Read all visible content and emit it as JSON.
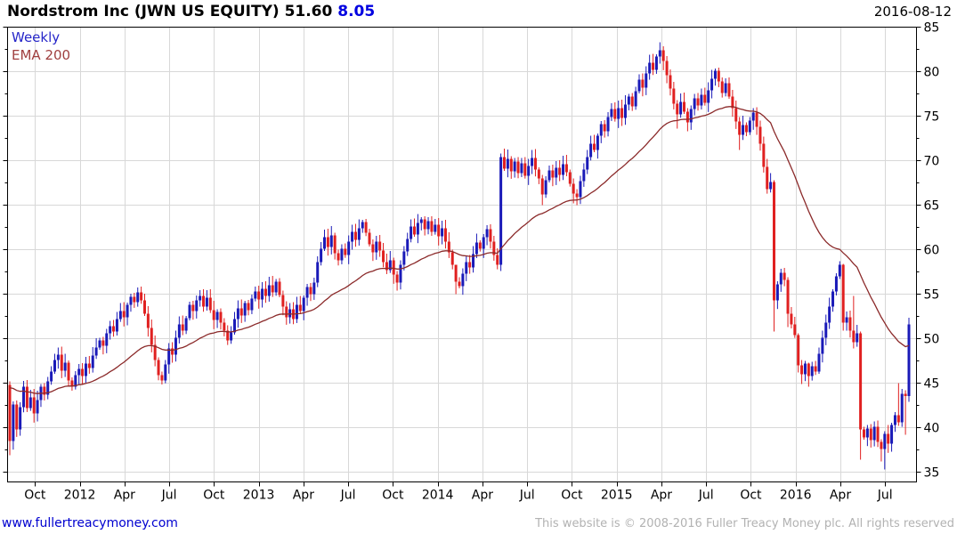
{
  "header": {
    "title_main": "Nordstrom Inc (JWN US EQUITY) 51.60",
    "change": "8.05",
    "date": "2016-08-12"
  },
  "legend": {
    "timeframe": "Weekly",
    "overlay": "EMA 200"
  },
  "footer": {
    "link": "www.fullertreacymoney.com",
    "copyright": "This website is © 2008-2016 Fuller Treacy Money plc. All rights reserved"
  },
  "colors": {
    "up_candle": "#1a1ab8",
    "down_candle": "#e02020",
    "ema_line": "#8b2a2a",
    "grid": "#d8d8d8",
    "axis": "#000000",
    "tick_label": "#000000"
  },
  "chart_data": {
    "type": "candlestick",
    "title": "Nordstrom Inc (JWN US EQUITY)",
    "timeframe": "weekly",
    "last_close": 51.6,
    "change": 8.05,
    "date": "2016-08-12",
    "y_axis": {
      "min_label": 35,
      "max_label": 85,
      "step": 5,
      "ticks": [
        85,
        80,
        75,
        70,
        65,
        60,
        55,
        50,
        45,
        40,
        35
      ],
      "minor_step": 2.5
    },
    "x_axis": {
      "tick_labels": [
        "Oct",
        "2012",
        "Apr",
        "Jul",
        "Oct",
        "2013",
        "Apr",
        "Jul",
        "Oct",
        "2014",
        "Apr",
        "Jul",
        "Oct",
        "2015",
        "Apr",
        "Jul",
        "Oct",
        "2016",
        "Apr",
        "Jul"
      ],
      "grid": true
    },
    "ema": {
      "label": "EMA 200",
      "period": 40
    },
    "series": {
      "name": "JWN weekly close",
      "first_open": 44.8,
      "closes": [
        38.5,
        42.6,
        39.8,
        42.3,
        44.6,
        42.2,
        43.4,
        41.6,
        43.1,
        44.6,
        43.7,
        45.2,
        46.3,
        47.6,
        48.2,
        46.4,
        47.3,
        45.3,
        44.6,
        45.9,
        46.6,
        45.8,
        47.2,
        46.7,
        48.1,
        49.0,
        49.8,
        49.2,
        50.6,
        51.4,
        50.8,
        52.2,
        53.1,
        52.4,
        53.8,
        54.7,
        54.1,
        55.2,
        54.3,
        52.8,
        51.2,
        49.3,
        47.6,
        45.9,
        45.3,
        47.1,
        48.9,
        48.2,
        50.1,
        51.6,
        50.9,
        52.3,
        53.8,
        53.1,
        54.3,
        54.8,
        53.6,
        54.6,
        53.2,
        52.1,
        53.0,
        51.8,
        50.9,
        49.8,
        50.7,
        52.2,
        53.4,
        52.6,
        54.0,
        53.2,
        54.5,
        55.3,
        54.4,
        55.6,
        54.8,
        56.0,
        55.2,
        56.4,
        54.9,
        53.6,
        52.4,
        53.3,
        52.2,
        53.8,
        53.1,
        54.6,
        55.8,
        55.0,
        56.3,
        58.6,
        60.1,
        61.4,
        60.3,
        61.6,
        59.6,
        58.8,
        60.1,
        59.4,
        60.9,
        62.0,
        61.1,
        62.4,
        63.1,
        61.9,
        60.6,
        59.7,
        60.9,
        59.9,
        58.6,
        57.7,
        58.8,
        57.2,
        56.3,
        58.3,
        59.8,
        61.2,
        62.6,
        61.7,
        63.0,
        63.4,
        62.3,
        63.2,
        62.0,
        62.8,
        61.5,
        62.4,
        60.9,
        59.7,
        58.3,
        56.4,
        55.9,
        57.3,
        58.6,
        58.0,
        59.5,
        60.8,
        60.1,
        61.4,
        62.3,
        60.9,
        59.4,
        58.3,
        70.4,
        69.1,
        70.2,
        68.8,
        69.9,
        68.6,
        69.7,
        68.3,
        69.4,
        70.3,
        69.0,
        68.0,
        66.2,
        67.8,
        68.9,
        68.1,
        69.2,
        68.4,
        69.6,
        68.7,
        67.4,
        66.3,
        65.9,
        67.7,
        69.0,
        70.4,
        71.9,
        71.2,
        72.8,
        74.1,
        73.3,
        74.9,
        75.8,
        74.7,
        75.9,
        74.8,
        76.3,
        77.2,
        76.1,
        77.8,
        79.1,
        78.2,
        79.8,
        81.0,
        80.2,
        81.7,
        82.4,
        81.2,
        79.6,
        78.1,
        76.4,
        75.2,
        76.6,
        75.5,
        74.3,
        75.8,
        77.0,
        76.2,
        77.4,
        76.5,
        77.9,
        79.2,
        80.1,
        78.9,
        77.6,
        78.7,
        77.2,
        75.9,
        74.4,
        72.9,
        74.0,
        73.2,
        74.5,
        75.4,
        73.8,
        71.9,
        69.3,
        66.8,
        67.6,
        54.3,
        56.1,
        57.4,
        56.6,
        52.8,
        51.6,
        50.4,
        47.0,
        46.0,
        47.2,
        45.8,
        46.9,
        46.3,
        48.3,
        50.1,
        51.8,
        53.6,
        55.3,
        57.0,
        58.3,
        51.8,
        52.4,
        50.9,
        49.6,
        50.6,
        39.8,
        38.9,
        39.9,
        38.6,
        40.1,
        38.4,
        37.6,
        39.3,
        38.2,
        40.3,
        41.4,
        40.6,
        43.8,
        43.55,
        51.6
      ],
      "wick_overrides": {
        "0": [
          36.9,
          45.2
        ],
        "129": [
          55.0,
          57.3
        ],
        "142": [
          57.6,
          70.8
        ],
        "154": [
          65.0,
          68.4
        ],
        "163": [
          65.2,
          68.0
        ],
        "188": [
          80.9,
          83.3
        ],
        "193": [
          73.6,
          76.8
        ],
        "196": [
          73.3,
          75.9
        ],
        "211": [
          71.2,
          74.9
        ],
        "221": [
          50.8,
          67.8
        ],
        "225": [
          51.3,
          56.9
        ],
        "228": [
          46.2,
          50.6
        ],
        "229": [
          44.9,
          47.6
        ],
        "231": [
          44.6,
          47.3
        ],
        "240": [
          56.7,
          58.7
        ],
        "241": [
          50.9,
          58.4
        ],
        "244": [
          48.9,
          54.8
        ],
        "246": [
          36.4,
          50.8
        ],
        "252": [
          36.2,
          38.7
        ],
        "253": [
          35.3,
          39.6
        ],
        "257": [
          40.2,
          45.0
        ],
        "259": [
          39.2,
          44.2
        ],
        "260": [
          42.9,
          52.35
        ]
      }
    }
  }
}
